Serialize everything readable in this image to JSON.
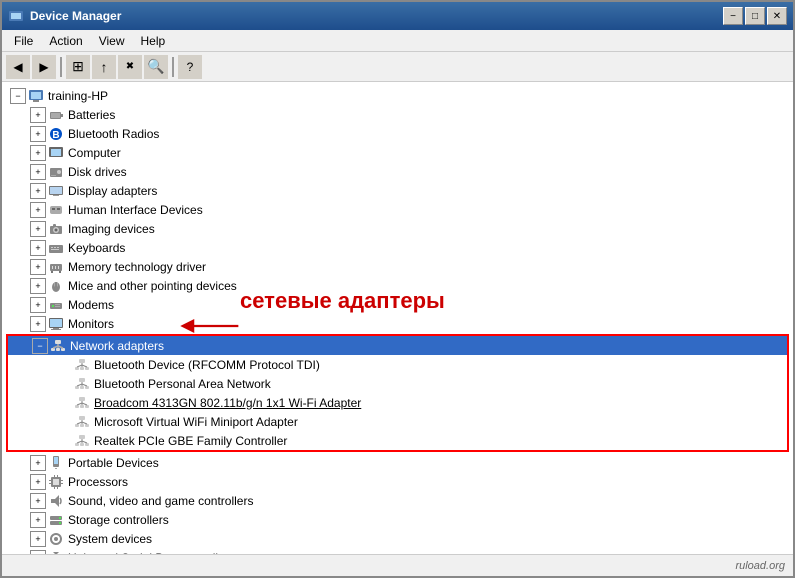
{
  "window": {
    "title": "Device Manager",
    "minimize_label": "−",
    "maximize_label": "□",
    "close_label": "✕"
  },
  "menu": {
    "items": [
      {
        "label": "File"
      },
      {
        "label": "Action"
      },
      {
        "label": "View"
      },
      {
        "label": "Help"
      }
    ]
  },
  "toolbar": {
    "buttons": [
      {
        "label": "◀",
        "name": "back"
      },
      {
        "label": "▶",
        "name": "forward"
      },
      {
        "label": "⊞",
        "name": "properties"
      },
      {
        "label": "▲",
        "name": "up"
      },
      {
        "label": "⟳",
        "name": "refresh"
      },
      {
        "label": "?",
        "name": "help"
      }
    ]
  },
  "tree": {
    "root": {
      "label": "training-HP",
      "expanded": true,
      "children": [
        {
          "label": "Batteries",
          "icon": "🔋",
          "expanded": false
        },
        {
          "label": "Bluetooth Radios",
          "icon": "⚡",
          "expanded": false
        },
        {
          "label": "Computer",
          "icon": "🖥",
          "expanded": false
        },
        {
          "label": "Disk drives",
          "icon": "💾",
          "expanded": false
        },
        {
          "label": "Display adapters",
          "icon": "📺",
          "expanded": false
        },
        {
          "label": "Human Interface Devices",
          "icon": "⌨",
          "expanded": false
        },
        {
          "label": "Imaging devices",
          "icon": "📷",
          "expanded": false
        },
        {
          "label": "Keyboards",
          "icon": "⌨",
          "expanded": false
        },
        {
          "label": "Memory technology driver",
          "icon": "📦",
          "expanded": false
        },
        {
          "label": "Mice and other pointing devices",
          "icon": "🖱",
          "expanded": false
        },
        {
          "label": "Modems",
          "icon": "📡",
          "expanded": false
        },
        {
          "label": "Monitors",
          "icon": "🖥",
          "expanded": false
        },
        {
          "label": "Network adapters",
          "icon": "🌐",
          "expanded": true,
          "selected": true,
          "children": [
            {
              "label": "Bluetooth Device (RFCOMM Protocol TDI)",
              "icon": "⚡"
            },
            {
              "label": "Bluetooth Personal Area Network",
              "icon": "⚡"
            },
            {
              "label": "Broadcom 4313GN 802.11b/g/n 1x1 Wi-Fi Adapter",
              "icon": "📶",
              "underline": true
            },
            {
              "label": "Microsoft Virtual WiFi Miniport Adapter",
              "icon": "📶"
            },
            {
              "label": "Realtek PCIe GBE Family Controller",
              "icon": "📶"
            }
          ]
        },
        {
          "label": "Portable Devices",
          "icon": "📱",
          "expanded": false
        },
        {
          "label": "Processors",
          "icon": "⚙",
          "expanded": false
        },
        {
          "label": "Sound, video and game controllers",
          "icon": "🔊",
          "expanded": false
        },
        {
          "label": "Storage controllers",
          "icon": "💽",
          "expanded": false
        },
        {
          "label": "System devices",
          "icon": "⚙",
          "expanded": false
        },
        {
          "label": "Universal Serial Bus controllers",
          "icon": "🔌",
          "expanded": false
        }
      ]
    }
  },
  "annotation": {
    "text": "сетевые адаптеры"
  },
  "watermark": {
    "text": "ruload.org"
  },
  "status_bar": {
    "text": ""
  }
}
